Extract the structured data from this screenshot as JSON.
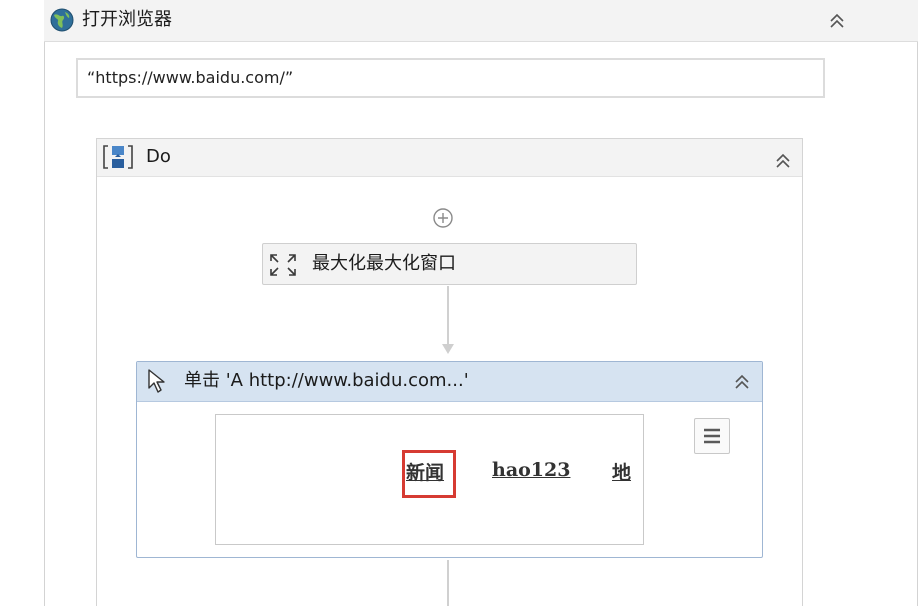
{
  "open_browser": {
    "title": "打开浏览器",
    "url": "“https://www.baidu.com/”"
  },
  "do_sequence": {
    "title": "Do"
  },
  "maximize_activity": {
    "label": "最大化最大化窗口"
  },
  "click_activity": {
    "title": "单击 'A  http://www.baidu.com...'",
    "preview": {
      "links": [
        "新闻",
        "hao123",
        "地"
      ]
    }
  },
  "colors": {
    "header_bg": "#f3f3f3",
    "click_header_bg": "#d6e3f1",
    "highlight": "#d63b32",
    "border": "#d4d4d4"
  }
}
